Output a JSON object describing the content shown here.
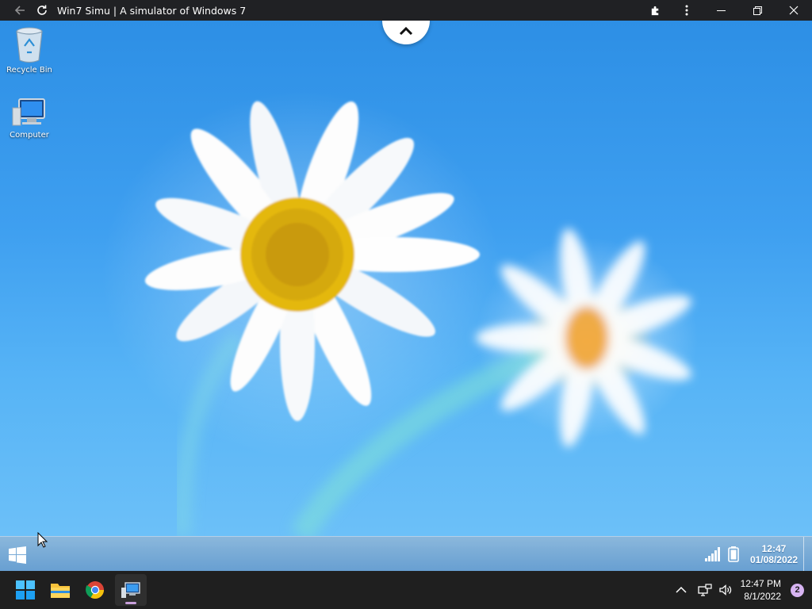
{
  "titlebar": {
    "title": "Win7 Simu | A simulator of Windows 7",
    "icons": [
      "back-arrow-icon",
      "reload-icon",
      "extensions-icon",
      "more-vert-icon",
      "minimize-icon",
      "restore-icon",
      "close-icon"
    ]
  },
  "desktop": {
    "icons": [
      {
        "label": "Recycle Bin",
        "icon": "recycle-bin-icon"
      },
      {
        "label": "Computer",
        "icon": "computer-icon"
      }
    ]
  },
  "win7_taskbar": {
    "clock_time": "12:47",
    "clock_date": "01/08/2022",
    "tray_icons": [
      "signal-icon",
      "battery-icon"
    ]
  },
  "host_taskbar": {
    "apps": [
      "windows-start-icon",
      "file-explorer-icon",
      "chrome-icon",
      "win7-simu-icon"
    ],
    "active_app": "win7-simu-icon",
    "clock_time": "12:47 PM",
    "clock_date": "8/1/2022",
    "notification_count": "2",
    "tray_icons": [
      "chevron-up-icon",
      "network-icon",
      "volume-icon"
    ]
  },
  "colors": {
    "titlebar_bg": "#202124",
    "host_taskbar_bg": "#1f1f1f",
    "sky_blue": "#3e9ff0",
    "notification_badge": "#d7b4f2"
  }
}
